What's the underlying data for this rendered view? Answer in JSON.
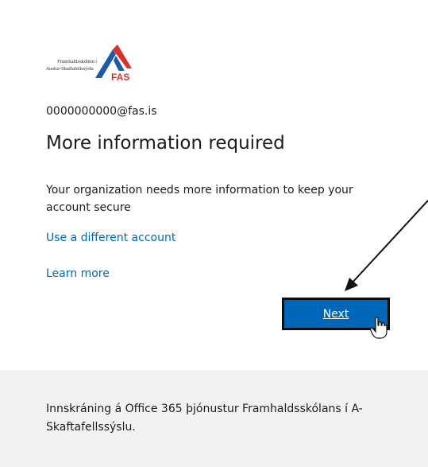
{
  "logo": {
    "line1": "Framhaldsskólinn í",
    "line2": "Austur-Skaftafellssýslu",
    "badge": "FAS",
    "colors": {
      "blue": "#1f5aa6",
      "red": "#d9312b"
    }
  },
  "account": {
    "email": "0000000000@fas.is"
  },
  "main": {
    "title": "More information required",
    "description": "Your organization needs more information to keep your account secure",
    "link_different_account": "Use a different account",
    "link_learn_more": "Learn more",
    "next_label": "Next"
  },
  "annotation": {
    "arrow_icon": "arrow-icon",
    "cursor_icon": "hand-cursor-icon"
  },
  "footer": {
    "text": "Innskráning á Office 365 þjónustur Framhaldsskólans í A-Skaftafellssýslu."
  },
  "colors": {
    "accent": "#0067b8",
    "footer_bg": "#f2f2f2"
  }
}
